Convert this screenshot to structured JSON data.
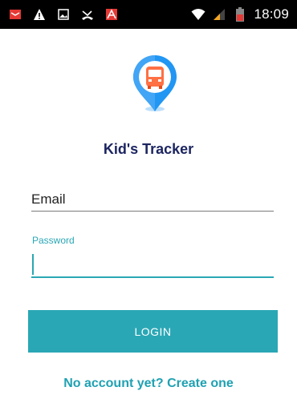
{
  "status_bar": {
    "time": "18:09",
    "left_icons": [
      "email-notification-icon",
      "warning-icon",
      "image-icon",
      "missed-call-icon",
      "app-notification-icon"
    ],
    "right_icons": [
      "wifi-icon",
      "signal-icon",
      "battery-icon"
    ]
  },
  "app": {
    "title": "Kid's Tracker",
    "logo_icon": "bus-location-pin-icon"
  },
  "form": {
    "email_placeholder": "Email",
    "email_value": "",
    "password_label": "Password",
    "password_value": "",
    "login_label": "LOGIN",
    "create_account_label": "No account yet? Create one"
  },
  "colors": {
    "accent": "#2aa7b5",
    "title": "#1c2560",
    "pin_blue": "#2196f3",
    "bus_orange": "#ff7043"
  }
}
